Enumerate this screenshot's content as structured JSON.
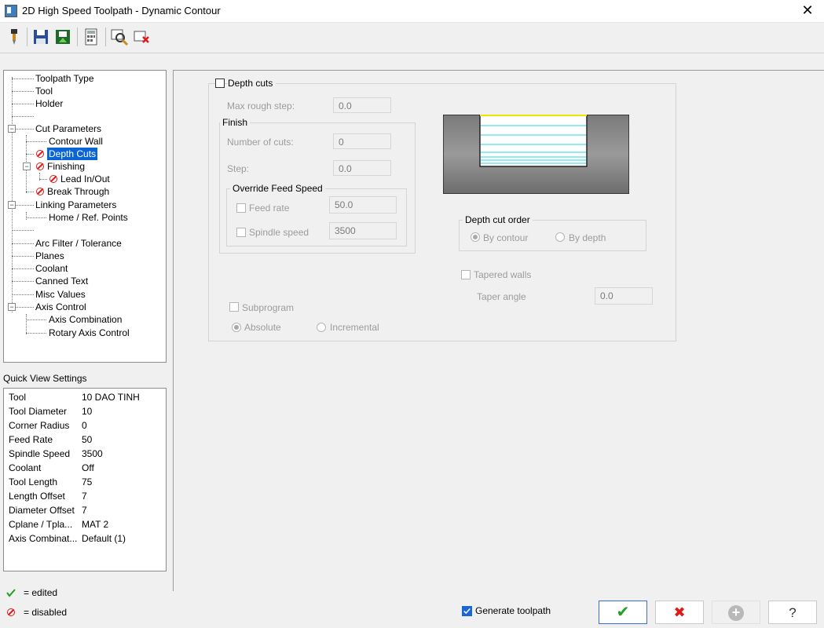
{
  "window": {
    "title": "2D High Speed Toolpath - Dynamic Contour",
    "close": "✕"
  },
  "toolbar": {
    "icons": [
      "toolpath-icon",
      "save-icon",
      "load-icon",
      "calculator-icon",
      "inspect-icon",
      "remove-icon"
    ]
  },
  "tree": {
    "items": [
      {
        "label": "Toolpath Type"
      },
      {
        "label": "Tool"
      },
      {
        "label": "Holder"
      },
      {
        "label": ""
      },
      {
        "label": "Cut Parameters"
      },
      {
        "label": "Contour Wall"
      },
      {
        "label": "Depth Cuts"
      },
      {
        "label": "Finishing"
      },
      {
        "label": "Lead In/Out"
      },
      {
        "label": "Break Through"
      },
      {
        "label": "Linking Parameters"
      },
      {
        "label": "Home / Ref. Points"
      },
      {
        "label": ""
      },
      {
        "label": "Arc Filter / Tolerance"
      },
      {
        "label": "Planes"
      },
      {
        "label": "Coolant"
      },
      {
        "label": "Canned Text"
      },
      {
        "label": "Misc Values"
      },
      {
        "label": "Axis Control"
      },
      {
        "label": "Axis Combination"
      },
      {
        "label": "Rotary Axis Control"
      }
    ]
  },
  "quick_view": {
    "title": "Quick View Settings",
    "rows": [
      {
        "k": "Tool",
        "v": "10 DAO TINH"
      },
      {
        "k": "Tool Diameter",
        "v": "10"
      },
      {
        "k": "Corner Radius",
        "v": "0"
      },
      {
        "k": "Feed Rate",
        "v": "50"
      },
      {
        "k": "Spindle Speed",
        "v": "3500"
      },
      {
        "k": "Coolant",
        "v": "Off"
      },
      {
        "k": "Tool Length",
        "v": "75"
      },
      {
        "k": "Length Offset",
        "v": "7"
      },
      {
        "k": "Diameter Offset",
        "v": "7"
      },
      {
        "k": "Cplane / Tpla...",
        "v": "MAT 2"
      },
      {
        "k": "Axis Combinat...",
        "v": "Default (1)"
      }
    ]
  },
  "legend": {
    "edited": "= edited",
    "disabled": "= disabled"
  },
  "depth_cuts": {
    "title": "Depth cuts",
    "max_rough_step_label": "Max rough step:",
    "max_rough_step": "0.0",
    "finish": {
      "title": "Finish",
      "num_cuts_label": "Number of cuts:",
      "num_cuts": "0",
      "step_label": "Step:",
      "step": "0.0",
      "override": {
        "title": "Override Feed Speed",
        "feed_label": "Feed rate",
        "feed": "50.0",
        "spindle_label": "Spindle speed",
        "spindle": "3500"
      }
    },
    "order": {
      "title": "Depth cut order",
      "by_contour": "By contour",
      "by_depth": "By depth"
    },
    "tapered_walls": "Tapered walls",
    "taper_angle_label": "Taper angle",
    "taper_angle": "0.0",
    "subprogram": "Subprogram",
    "absolute": "Absolute",
    "incremental": "Incremental"
  },
  "footer": {
    "generate_label": "Generate toolpath",
    "ok": "✔",
    "cancel": "✖",
    "add": "+",
    "help": "?"
  },
  "colors": {
    "selection": "#0a64d6",
    "ok_green": "#22a020",
    "cancel_red": "#e01818"
  }
}
